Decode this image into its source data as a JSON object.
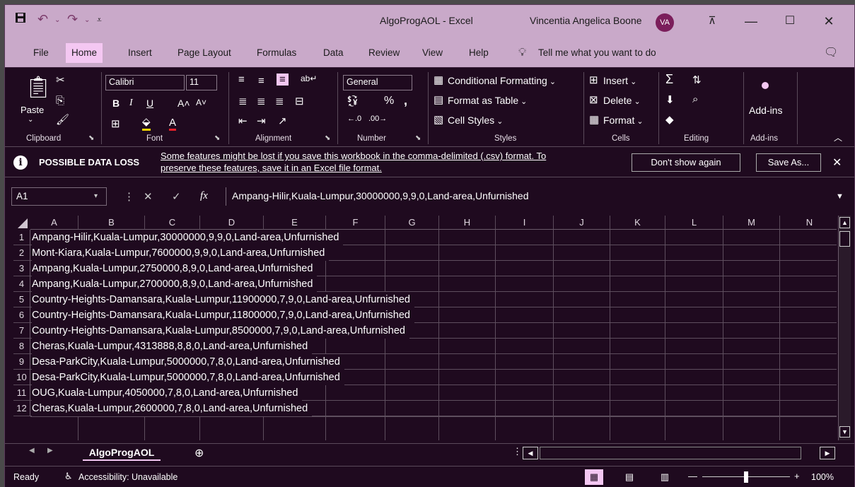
{
  "title_bar": {
    "document_title": "AlgoProgAOL  -  Excel",
    "user_name": "Vincentia Angelica Boone",
    "user_initials": "VA",
    "icons": [
      "save-icon",
      "undo-icon",
      "redo-icon",
      "customize-qat-icon",
      "ribbon-display-icon",
      "minimize-icon",
      "maximize-icon",
      "close-icon"
    ]
  },
  "tabs": {
    "items": [
      "File",
      "Home",
      "Insert",
      "Page Layout",
      "Formulas",
      "Data",
      "Review",
      "View",
      "Help"
    ],
    "active": "Home",
    "tell_me": "Tell me what you want to do"
  },
  "ribbon": {
    "clipboard": {
      "paste": "Paste",
      "label": "Clipboard"
    },
    "font": {
      "family": "Calibri",
      "size": "11",
      "label": "Font"
    },
    "alignment": {
      "label": "Alignment"
    },
    "number": {
      "format": "General",
      "label": "Number",
      "percent": "%",
      "comma": ","
    },
    "styles": {
      "conditional": "Conditional Formatting",
      "table": "Format as Table",
      "cell_styles": "Cell Styles",
      "label": "Styles"
    },
    "cells": {
      "insert": "Insert",
      "delete": "Delete",
      "format": "Format",
      "label": "Cells"
    },
    "editing": {
      "label": "Editing"
    },
    "addins": {
      "button": "Add-ins",
      "label": "Add-ins"
    }
  },
  "infobar": {
    "title": "POSSIBLE DATA LOSS",
    "message_line1": "Some features might be lost if you save this workbook in the comma-delimited (.csv) format. To",
    "message_line2": "preserve these features, save it in an Excel file format.",
    "dont_show": "Don't show again",
    "save_as": "Save As..."
  },
  "formula_bar": {
    "name_box": "A1",
    "fx": "fx",
    "content": "Ampang-Hilir,Kuala-Lumpur,30000000,9,9,0,Land-area,Unfurnished"
  },
  "sheet": {
    "columns": [
      "A",
      "B",
      "C",
      "D",
      "E",
      "F",
      "G",
      "H",
      "I",
      "J",
      "K",
      "L",
      "M",
      "N"
    ],
    "rows": [
      {
        "num": "1",
        "text": "Ampang-Hilir,Kuala-Lumpur,30000000,9,9,0,Land-area,Unfurnished"
      },
      {
        "num": "2",
        "text": "Mont-Kiara,Kuala-Lumpur,7600000,9,9,0,Land-area,Unfurnished"
      },
      {
        "num": "3",
        "text": "Ampang,Kuala-Lumpur,2750000,8,9,0,Land-area,Unfurnished"
      },
      {
        "num": "4",
        "text": "Ampang,Kuala-Lumpur,2700000,8,9,0,Land-area,Unfurnished"
      },
      {
        "num": "5",
        "text": "Country-Heights-Damansara,Kuala-Lumpur,11900000,7,9,0,Land-area,Unfurnished"
      },
      {
        "num": "6",
        "text": "Country-Heights-Damansara,Kuala-Lumpur,11800000,7,9,0,Land-area,Unfurnished"
      },
      {
        "num": "7",
        "text": "Country-Heights-Damansara,Kuala-Lumpur,8500000,7,9,0,Land-area,Unfurnished"
      },
      {
        "num": "8",
        "text": "Cheras,Kuala-Lumpur,4313888,8,8,0,Land-area,Unfurnished"
      },
      {
        "num": "9",
        "text": "Desa-ParkCity,Kuala-Lumpur,5000000,7,8,0,Land-area,Unfurnished"
      },
      {
        "num": "10",
        "text": "Desa-ParkCity,Kuala-Lumpur,5000000,7,8,0,Land-area,Unfurnished"
      },
      {
        "num": "11",
        "text": "OUG,Kuala-Lumpur,4050000,7,8,0,Land-area,Unfurnished"
      },
      {
        "num": "12",
        "text": "Cheras,Kuala-Lumpur,2600000,7,8,0,Land-area,Unfurnished"
      }
    ],
    "active_tab": "AlgoProgAOL"
  },
  "status": {
    "ready": "Ready",
    "accessibility": "Accessibility: Unavailable",
    "zoom": "100%"
  }
}
